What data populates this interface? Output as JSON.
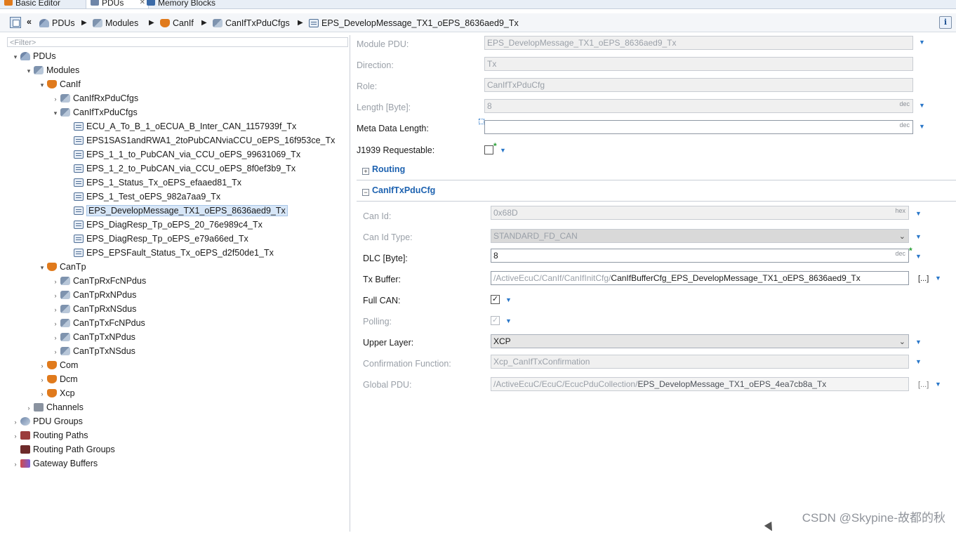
{
  "tabs": [
    {
      "label": "Basic Editor",
      "icon": "basic-editor-icon"
    },
    {
      "label": "PDUs",
      "icon": "pdus-icon",
      "close": "✕"
    },
    {
      "label": "Memory Blocks",
      "icon": "memory-blocks-icon"
    }
  ],
  "breadcrumb": {
    "back": "«",
    "items": [
      "PDUs",
      "Modules",
      "CanIf",
      "CanIfTxPduCfgs",
      "EPS_DevelopMessage_TX1_oEPS_8636aed9_Tx"
    ],
    "separator": "▶"
  },
  "info_button": "i",
  "tree": {
    "filter_placeholder": "<Filter>",
    "nodes": [
      {
        "label": "PDUs",
        "twisty": "▾",
        "icon": "pdus-icon"
      },
      {
        "label": "Modules",
        "twisty": "▾",
        "icon": "modules-icon"
      },
      {
        "label": "CanIf",
        "twisty": "▾",
        "icon": "canif-icon"
      },
      {
        "label": "CanIfRxPduCfgs",
        "twisty": "›",
        "icon": "pdu-cfg-icon"
      },
      {
        "label": "CanIfTxPduCfgs",
        "twisty": "▾",
        "icon": "pdu-cfg-icon"
      },
      {
        "label": "ECU_A_To_B_1_oECUA_B_Inter_CAN_1157939f_Tx",
        "twisty": "",
        "icon": "message-icon"
      },
      {
        "label": "EPS1SAS1andRWA1_2toPubCANviaCCU_oEPS_16f953ce_Tx",
        "twisty": "",
        "icon": "message-icon"
      },
      {
        "label": "EPS_1_1_to_PubCAN_via_CCU_oEPS_99631069_Tx",
        "twisty": "",
        "icon": "message-icon"
      },
      {
        "label": "EPS_1_2_to_PubCAN_via_CCU_oEPS_8f0ef3b9_Tx",
        "twisty": "",
        "icon": "message-icon"
      },
      {
        "label": "EPS_1_Status_Tx_oEPS_efaaed81_Tx",
        "twisty": "",
        "icon": "message-icon"
      },
      {
        "label": "EPS_1_Test_oEPS_982a7aa9_Tx",
        "twisty": "",
        "icon": "message-icon"
      },
      {
        "label": "EPS_DevelopMessage_TX1_oEPS_8636aed9_Tx",
        "twisty": "",
        "icon": "message-icon",
        "selected": true
      },
      {
        "label": "EPS_DiagResp_Tp_oEPS_20_76e989c4_Tx",
        "twisty": "",
        "icon": "message-icon"
      },
      {
        "label": "EPS_DiagResp_Tp_oEPS_e79a66ed_Tx",
        "twisty": "",
        "icon": "message-icon"
      },
      {
        "label": "EPS_EPSFault_Status_Tx_oEPS_d2f50de1_Tx",
        "twisty": "",
        "icon": "message-icon"
      },
      {
        "label": "CanTp",
        "twisty": "▾",
        "icon": "cantp-icon"
      },
      {
        "label": "CanTpRxFcNPdus",
        "twisty": "›",
        "icon": "pdu-cfg-icon"
      },
      {
        "label": "CanTpRxNPdus",
        "twisty": "›",
        "icon": "pdu-cfg-icon"
      },
      {
        "label": "CanTpRxNSdus",
        "twisty": "›",
        "icon": "pdu-cfg-icon"
      },
      {
        "label": "CanTpTxFcNPdus",
        "twisty": "›",
        "icon": "pdu-cfg-icon"
      },
      {
        "label": "CanTpTxNPdus",
        "twisty": "›",
        "icon": "pdu-cfg-icon"
      },
      {
        "label": "CanTpTxNSdus",
        "twisty": "›",
        "icon": "pdu-cfg-icon"
      },
      {
        "label": "Com",
        "twisty": "›",
        "icon": "com-icon"
      },
      {
        "label": "Dcm",
        "twisty": "›",
        "icon": "dcm-icon"
      },
      {
        "label": "Xcp",
        "twisty": "›",
        "icon": "xcp-icon"
      },
      {
        "label": "Channels",
        "twisty": "›",
        "icon": "channels-icon"
      },
      {
        "label": "PDU Groups",
        "twisty": "›",
        "icon": "pdu-groups-icon"
      },
      {
        "label": "Routing Paths",
        "twisty": "›",
        "icon": "routing-paths-icon"
      },
      {
        "label": "Routing Path Groups",
        "twisty": "",
        "icon": "routing-path-groups-icon"
      },
      {
        "label": "Gateway Buffers",
        "twisty": "›",
        "icon": "gateway-buffers-icon"
      }
    ]
  },
  "properties": {
    "module_pdu": {
      "label": "Module PDU:",
      "value": "EPS_DevelopMessage_TX1_oEPS_8636aed9_Tx"
    },
    "direction": {
      "label": "Direction:",
      "value": "Tx"
    },
    "role": {
      "label": "Role:",
      "value": "CanIfTxPduCfg"
    },
    "length": {
      "label": "Length [Byte]:",
      "value": "8",
      "unit": "dec"
    },
    "meta_data_length": {
      "label": "Meta Data Length:",
      "value": "",
      "unit": "dec"
    },
    "j1939": {
      "label": "J1939 Requestable:",
      "checked": false
    }
  },
  "sections": {
    "routing": {
      "toggle": "+",
      "title": "Routing"
    },
    "caniftx": {
      "toggle": "−",
      "title": "CanIfTxPduCfg"
    }
  },
  "caniftx": {
    "can_id": {
      "label": "Can Id:",
      "value": "0x68D",
      "unit": "hex"
    },
    "can_id_type": {
      "label": "Can Id Type:",
      "value": "STANDARD_FD_CAN"
    },
    "dlc": {
      "label": "DLC [Byte]:",
      "value": "8",
      "unit": "dec"
    },
    "tx_buffer": {
      "label": "Tx Buffer:",
      "prefix": "/ActiveEcuC/CanIf/CanIfInitCfg/",
      "value": "CanIfBufferCfg_EPS_DevelopMessage_TX1_oEPS_8636aed9_Tx",
      "browse": "[...]"
    },
    "full_can": {
      "label": "Full CAN:",
      "checked": true
    },
    "polling": {
      "label": "Polling:",
      "checked": true
    },
    "upper_layer": {
      "label": "Upper Layer:",
      "value": "XCP"
    },
    "confirmation": {
      "label": "Confirmation Function:",
      "value": "Xcp_CanIfTxConfirmation"
    },
    "global_pdu": {
      "label": "Global PDU:",
      "prefix": "/ActiveEcuC/EcuC/EcucPduCollection/",
      "value": "EPS_DevelopMessage_TX1_oEPS_4ea7cb8a_Tx",
      "browse": "[...]"
    }
  },
  "watermark": "CSDN @Skypine-故都的秋",
  "colors": {
    "accent": "#1d62b0",
    "selection": "#d7e6f7",
    "disabled_text": "#9aa0a8"
  }
}
